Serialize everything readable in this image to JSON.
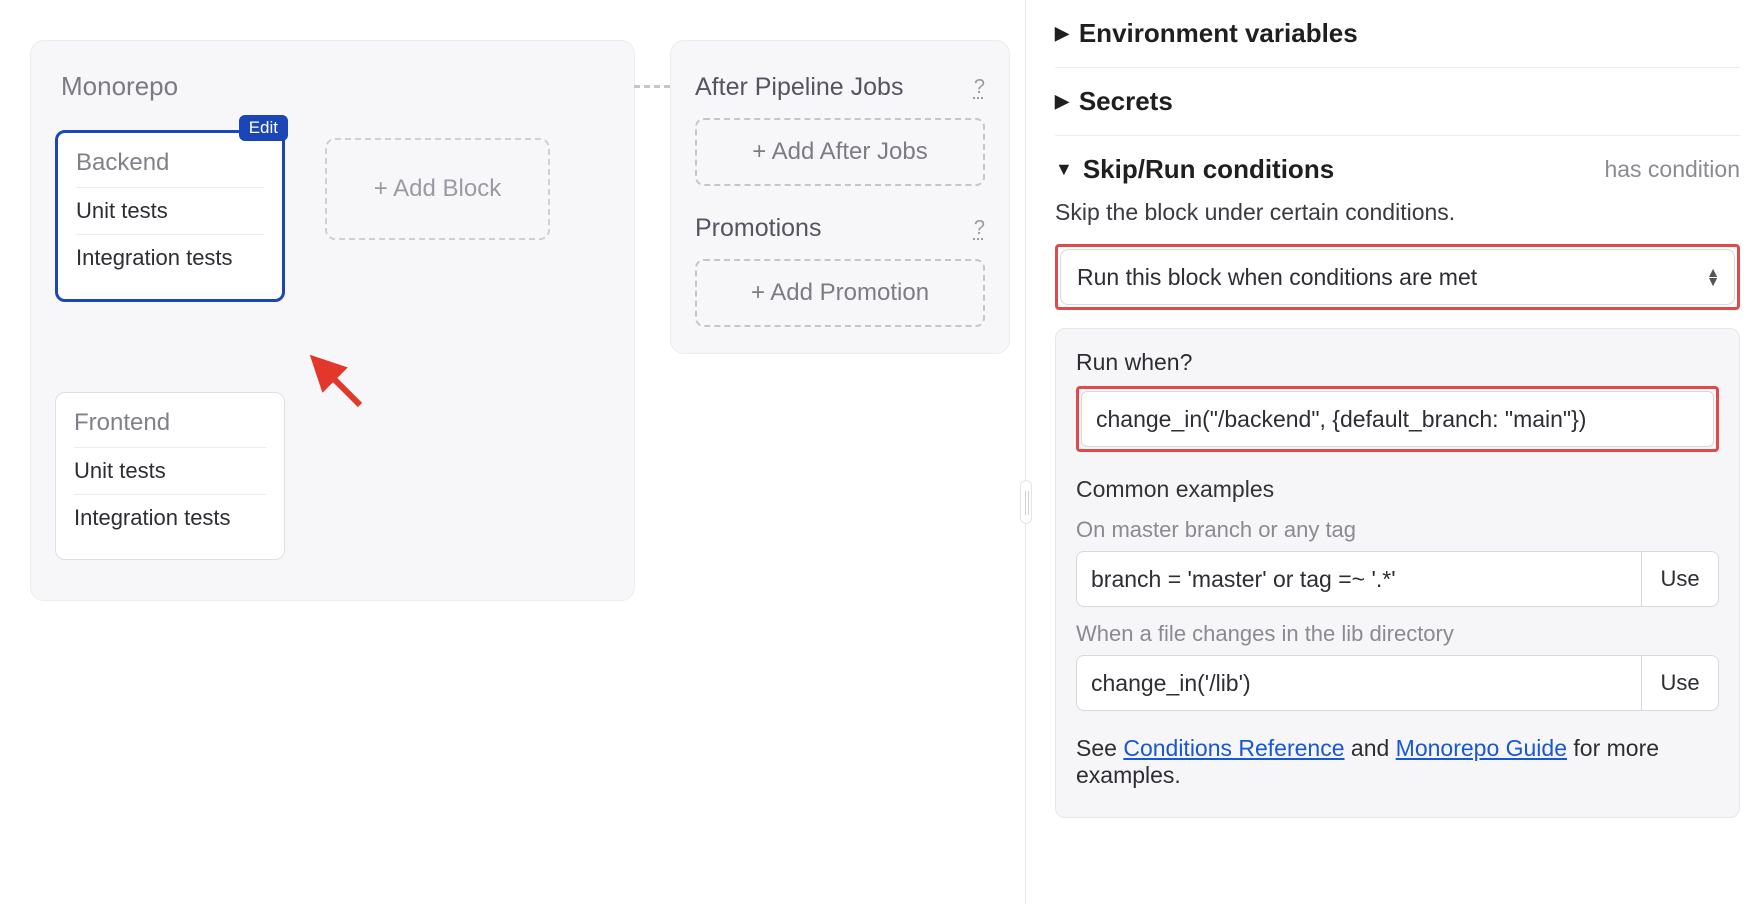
{
  "pipeline": {
    "title": "Monorepo",
    "edit_badge": "Edit",
    "blocks": [
      {
        "name": "Backend",
        "jobs": [
          "Unit tests",
          "Integration tests"
        ],
        "selected": true
      },
      {
        "name": "Frontend",
        "jobs": [
          "Unit tests",
          "Integration tests"
        ],
        "selected": false
      }
    ],
    "add_block_label": "+ Add Block"
  },
  "after": {
    "title": "After Pipeline Jobs",
    "add_after_label": "+ Add After Jobs",
    "promotions_title": "Promotions",
    "add_promotion_label": "+ Add Promotion",
    "help_glyph": "?"
  },
  "panel": {
    "env_title": "Environment variables",
    "secrets_title": "Secrets",
    "conditions": {
      "title": "Skip/Run conditions",
      "badge": "has condition",
      "description": "Skip the block under certain conditions.",
      "select_value": "Run this block when conditions are met",
      "run_when_label": "Run when?",
      "run_when_value": "change_in(\"/backend\", {default_branch: \"main\"})",
      "examples_title": "Common examples",
      "example1_desc": "On master branch or any tag",
      "example1_value": "branch = 'master' or tag =~ '.*'",
      "example2_desc": "When a file changes in the lib directory",
      "example2_value": "change_in('/lib')",
      "use_label": "Use",
      "ref_prefix": "See ",
      "ref_link1": "Conditions Reference",
      "ref_mid": " and ",
      "ref_link2": "Monorepo Guide",
      "ref_suffix": " for more examples."
    }
  }
}
